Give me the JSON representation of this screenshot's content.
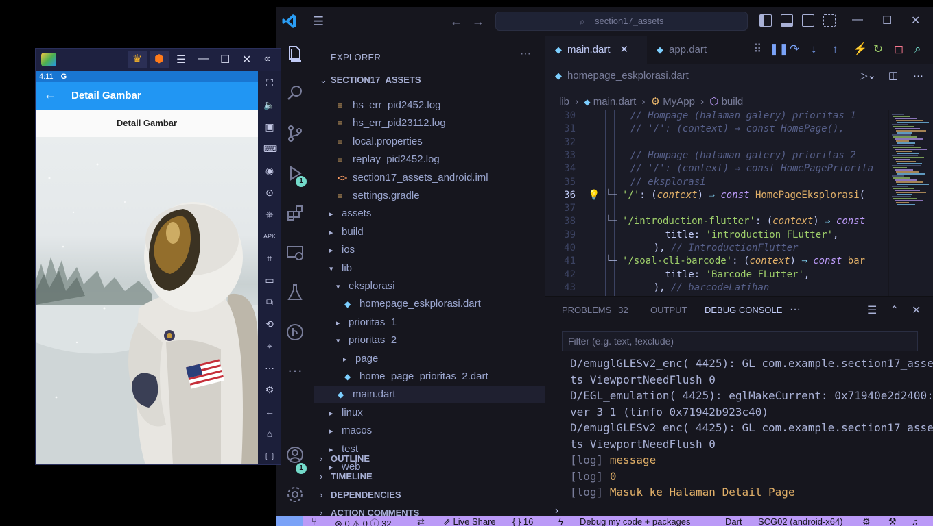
{
  "vscode": {
    "search_text": "section17_assets",
    "explorer_title": "EXPLORER",
    "project_name": "SECTION17_ASSETS",
    "activity_badges": {
      "run_debug": "1",
      "accounts": "1"
    },
    "file_tree": [
      {
        "label": "hs_err_pid2452.log",
        "icon": "log",
        "indent": 1,
        "type": "file"
      },
      {
        "label": "hs_err_pid23112.log",
        "icon": "log",
        "indent": 1,
        "type": "file"
      },
      {
        "label": "local.properties",
        "icon": "props",
        "indent": 1,
        "type": "file"
      },
      {
        "label": "replay_pid2452.log",
        "icon": "log",
        "indent": 1,
        "type": "file"
      },
      {
        "label": "section17_assets_android.iml",
        "icon": "iml",
        "indent": 1,
        "type": "file"
      },
      {
        "label": "settings.gradle",
        "icon": "gradle",
        "indent": 1,
        "type": "file"
      },
      {
        "label": "assets",
        "indent": 0,
        "type": "folder-closed"
      },
      {
        "label": "build",
        "indent": 0,
        "type": "folder-closed"
      },
      {
        "label": "ios",
        "indent": 0,
        "type": "folder-closed"
      },
      {
        "label": "lib",
        "indent": 0,
        "type": "folder-open"
      },
      {
        "label": "eksplorasi",
        "indent": 1,
        "type": "folder-open"
      },
      {
        "label": "homepage_eskplorasi.dart",
        "icon": "dart",
        "indent": 2,
        "type": "file"
      },
      {
        "label": "prioritas_1",
        "indent": 1,
        "type": "folder-closed"
      },
      {
        "label": "prioritas_2",
        "indent": 1,
        "type": "folder-open"
      },
      {
        "label": "page",
        "indent": 2,
        "type": "folder-closed"
      },
      {
        "label": "home_page_prioritas_2.dart",
        "icon": "dart",
        "indent": 2,
        "type": "file"
      },
      {
        "label": "main.dart",
        "icon": "dart",
        "indent": 1,
        "type": "file",
        "selected": true
      },
      {
        "label": "linux",
        "indent": 0,
        "type": "folder-closed"
      },
      {
        "label": "macos",
        "indent": 0,
        "type": "folder-closed"
      },
      {
        "label": "test",
        "indent": 0,
        "type": "folder-closed"
      },
      {
        "label": "web",
        "indent": 0,
        "type": "folder-closed"
      }
    ],
    "sections": [
      "OUTLINE",
      "TIMELINE",
      "DEPENDENCIES",
      "ACTION COMMENTS"
    ],
    "tabs": [
      {
        "label": "main.dart",
        "active": true
      },
      {
        "label": "app.dart",
        "active": false
      }
    ],
    "subtab": "homepage_eskplorasi.dart",
    "breadcrumb": [
      "lib",
      "main.dart",
      "MyApp",
      "build"
    ],
    "code_lines": [
      {
        "n": "30",
        "html": "<span class=\"cm\">// Hompage (halaman galery) prioritas 1</span>"
      },
      {
        "n": "31",
        "html": "<span class=\"cm\">// '/': (context) ⇒ const HomePage(),</span>"
      },
      {
        "n": "32",
        "html": ""
      },
      {
        "n": "33",
        "html": "<span class=\"cm\">// Hompage (halaman galery) prioritas 2</span>"
      },
      {
        "n": "34",
        "html": "<span class=\"cm\">// '/': (context) ⇒ const HomePagePriorita</span>"
      },
      {
        "n": "35",
        "html": "<span class=\"cm\">// eksplorasi</span>"
      },
      {
        "n": "36",
        "html": "<span class=\"str\">'/'</span><span class=\"pun\">: (</span><span class=\"par\">context</span><span class=\"pun\">) </span><span class=\"op\">⇒</span> <span class=\"kw\">const</span> <span class=\"cls\">HomePageEksplorasi</span><span class=\"pun\">(</span>"
      },
      {
        "n": "37",
        "html": ""
      },
      {
        "n": "38",
        "html": "<span class=\"str\">'/introduction-flutter'</span><span class=\"pun\">: (</span><span class=\"par\">context</span><span class=\"pun\">) </span><span class=\"op\">⇒</span> <span class=\"kw\">const</span>"
      },
      {
        "n": "39",
        "html": "      <span class=\"pun\">title: </span><span class=\"str\">'introduction FLutter'</span><span class=\"pun\">,</span>"
      },
      {
        "n": "40",
        "html": "    <span class=\"pun\">),</span> <span class=\"cm\">// IntroductionFlutter</span>"
      },
      {
        "n": "41",
        "html": "<span class=\"str\">'/soal-cli-barcode'</span><span class=\"pun\">: (</span><span class=\"par\">context</span><span class=\"pun\">) </span><span class=\"op\">⇒</span> <span class=\"kw\">const</span> <span class=\"cls\">bar</span>"
      },
      {
        "n": "42",
        "html": "      <span class=\"pun\">title: </span><span class=\"str\">'Barcode FLutter'</span><span class=\"pun\">,</span>"
      },
      {
        "n": "43",
        "html": "    <span class=\"pun\">),</span> <span class=\"cm\">// barcodeLatihan</span>"
      }
    ],
    "panel_tabs": [
      {
        "label": "PROBLEMS",
        "badge": "32"
      },
      {
        "label": "OUTPUT",
        "badge": ""
      },
      {
        "label": "DEBUG CONSOLE",
        "badge": ""
      }
    ],
    "filter_placeholder": "Filter (e.g. text, !exclude)",
    "console_lines": [
      {
        "text": "D/emuglGLESv2_enc( 4425): GL com.example.section17_asse"
      },
      {
        "text": "ts ViewportNeedFlush 0"
      },
      {
        "text": "D/EGL_emulation( 4425): eglMakeCurrent: 0x71940e2d2400:"
      },
      {
        "text": "ver 3 1 (tinfo 0x71942b923c40)"
      },
      {
        "text": "D/emuglGLESv2_enc( 4425): GL com.example.section17_asse"
      },
      {
        "text": "ts ViewportNeedFlush 0"
      },
      {
        "tag": "[log]",
        "msg": "message"
      },
      {
        "tag": "[log]",
        "msg": "0"
      },
      {
        "tag": "[log]",
        "msg": "Masuk ke Halaman Detail Page"
      }
    ],
    "statusbar": {
      "errors": "0",
      "warnings": "0",
      "infos": "32",
      "live_share": "Live Share",
      "braces": "{ } 16",
      "debug_label": "Debug my code + packages",
      "lang": "Dart",
      "device": "SCG02 (android-x64)"
    }
  },
  "emulator": {
    "time": "4:11",
    "status_g": "G",
    "appbar_title": "Detail Gambar",
    "header": "Detail Gambar"
  },
  "colors": {
    "vscode_bg": "#1a1b26",
    "sidebar_bg": "#16161e",
    "accent": "#bb9af7",
    "appbar": "#2196f3",
    "statusbar_phone": "#1976d2"
  }
}
